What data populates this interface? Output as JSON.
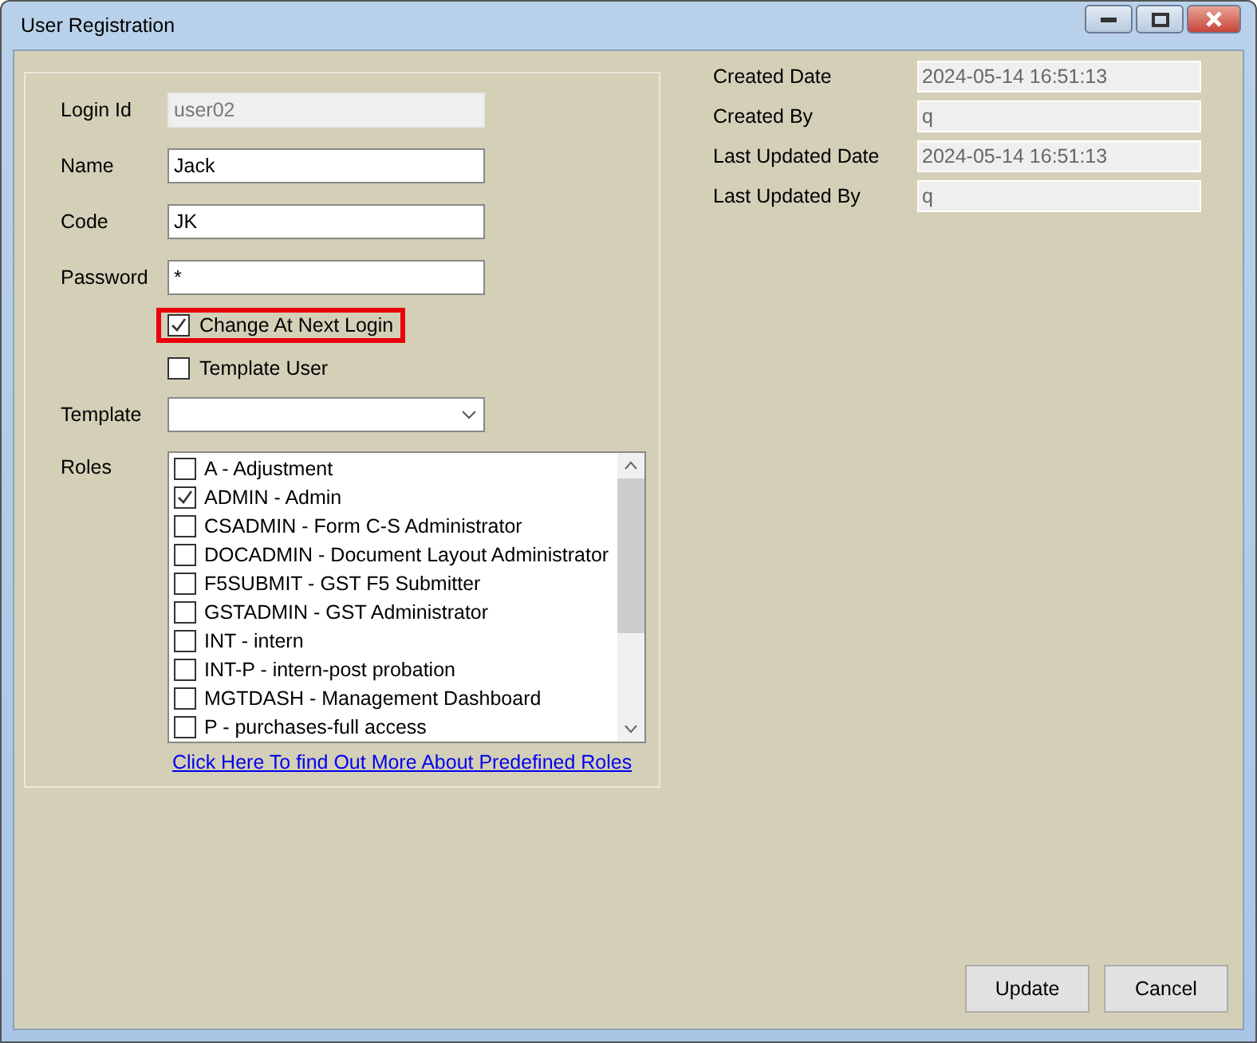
{
  "window": {
    "title": "User Registration"
  },
  "fields": [
    {
      "label": "Login Id",
      "value": "user02",
      "disabled": true
    },
    {
      "label": "Name",
      "value": "Jack",
      "disabled": false
    },
    {
      "label": "Code",
      "value": "JK",
      "disabled": false
    },
    {
      "label": "Password",
      "value": "*",
      "disabled": false
    }
  ],
  "checkboxes": [
    {
      "label": "Change At Next Login",
      "checked": true,
      "highlighted": true
    },
    {
      "label": "Template User",
      "checked": false,
      "highlighted": false
    }
  ],
  "template": {
    "label": "Template"
  },
  "roles": {
    "label": "Roles",
    "items": [
      {
        "label": "A - Adjustment",
        "checked": false
      },
      {
        "label": "ADMIN - Admin",
        "checked": true
      },
      {
        "label": "CSADMIN - Form C-S Administrator",
        "checked": false
      },
      {
        "label": "DOCADMIN - Document Layout Administrator",
        "checked": false
      },
      {
        "label": "F5SUBMIT - GST F5 Submitter",
        "checked": false
      },
      {
        "label": "GSTADMIN - GST Administrator",
        "checked": false
      },
      {
        "label": "INT - intern",
        "checked": false
      },
      {
        "label": "INT-P - intern-post probation",
        "checked": false
      },
      {
        "label": "MGTDASH - Management Dashboard",
        "checked": false
      },
      {
        "label": "P - purchases-full access",
        "checked": false
      }
    ],
    "link": "Click Here To find Out More About Predefined Roles"
  },
  "audit": [
    {
      "label": "Created Date",
      "value": "2024-05-14 16:51:13"
    },
    {
      "label": "Created By",
      "value": "q"
    },
    {
      "label": "Last Updated Date",
      "value": "2024-05-14 16:51:13"
    },
    {
      "label": "Last Updated By",
      "value": "q"
    }
  ],
  "buttons": [
    "Update",
    "Cancel"
  ]
}
